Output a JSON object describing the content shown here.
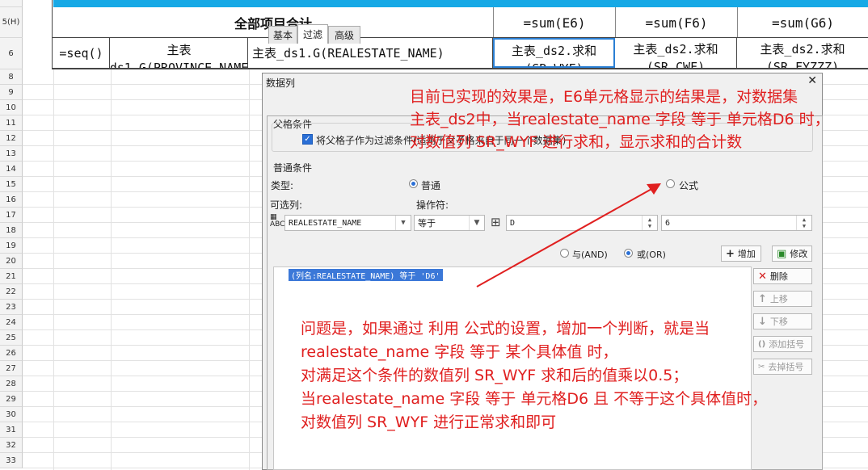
{
  "sheet": {
    "row_headers": [
      "5(H)",
      "6",
      "8",
      "9",
      "10",
      "11",
      "12",
      "13",
      "14",
      "15",
      "16",
      "17",
      "18",
      "19",
      "20",
      "21",
      "22",
      "23",
      "24",
      "25",
      "26",
      "27",
      "28",
      "29",
      "30",
      "31",
      "32",
      "33"
    ],
    "header_title": "全部项目合计",
    "sum_e": "=sum(E6)",
    "sum_f": "=sum(F6)",
    "sum_g": "=sum(G6)",
    "cell_a6": "=seq()",
    "cell_b6": "主表_ds1.G(PROVINCE_NAME)",
    "cell_d6": "主表_ds1.G(REALESTATE_NAME)",
    "cell_e6": "主表_ds2.求和(SR_WYF)",
    "cell_f6": "主表_ds2.求和(SR_CWF)",
    "cell_g6": "主表_ds2.求和(SR_FYZZZ)",
    "accent": "#17a9e6"
  },
  "dialog": {
    "title": "数据列",
    "close_icon": "close-icon",
    "tabs": [
      "基本",
      "过滤",
      "高级"
    ],
    "active_tab": "过滤",
    "parent_group": "父格条件",
    "parent_checkbox_label": "将父格子作为过滤条件(适用于父子格来自于同一个数据集)",
    "normal_group": "普通条件",
    "type_label": "类型:",
    "type_normal": "普通",
    "type_formula": "公式",
    "column_label": "可选列:",
    "operator_label": "操作符:",
    "column_value": "REALESTATE_NAME",
    "operator_value": "等于",
    "cell_ref_value": "D",
    "row_value": "6",
    "and_label": "与(AND)",
    "or_label": "或(OR)",
    "add_button": "增加",
    "modify_button": "修改",
    "filter_item": "(列名:REALESTATE_NAME) 等于 'D6'",
    "delete_button": "删除",
    "up_button": "上移",
    "down_button": "下移",
    "add_bracket_button": "添加括号",
    "remove_bracket_button": "去掉括号"
  },
  "notes": {
    "top": [
      "目前已实现的效果是，E6单元格显示的结果是，对数据集",
      "主表_ds2中，当realestate_name 字段 等于 单元格D6 时，",
      "对数值列 SR_WYF 进行求和，显示求和的合计数"
    ],
    "bottom": [
      "问题是，如果通过 利用 公式的设置，增加一个判断，就是当",
      "realestate_name 字段 等于 某个具体值 时，",
      "对满足这个条件的数值列 SR_WYF 求和后的值乘以0.5；",
      "当realestate_name 字段 等于 单元格D6 且 不等于这个具体值时，",
      "对数值列 SR_WYF 进行正常求和即可"
    ],
    "color": "#e02020"
  }
}
